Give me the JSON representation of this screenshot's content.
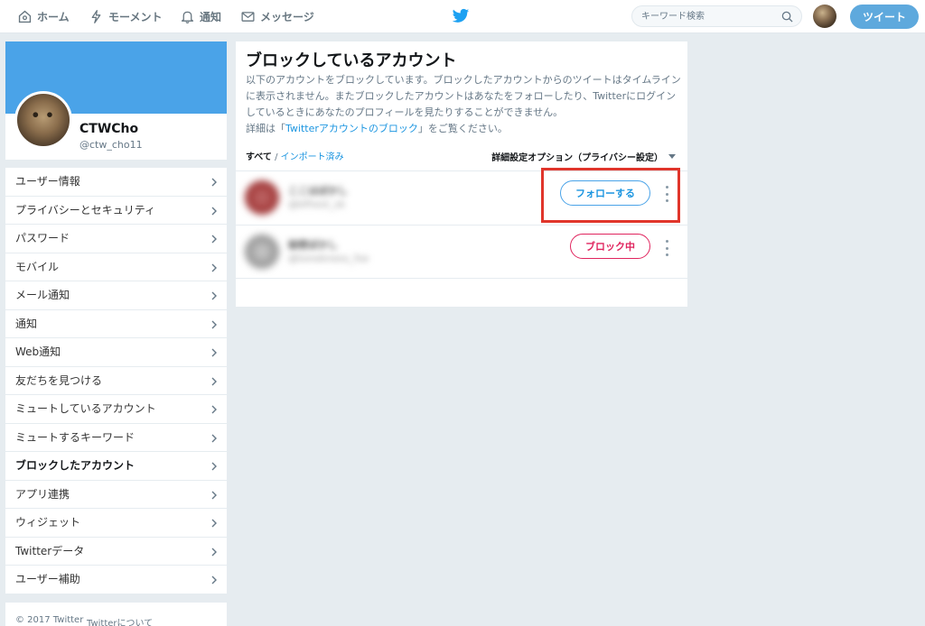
{
  "nav": {
    "home": "ホーム",
    "moments": "モーメント",
    "notifications": "通知",
    "messages": "メッセージ"
  },
  "search": {
    "placeholder": "キーワード検索"
  },
  "tweet_button": "ツイート",
  "profile": {
    "name": "CTWCho",
    "handle": "@ctw_cho11"
  },
  "menu": [
    "ユーザー情報",
    "プライバシーとセキュリティ",
    "パスワード",
    "モバイル",
    "メール通知",
    "通知",
    "Web通知",
    "友だちを見つける",
    "ミュートしているアカウント",
    "ミュートするキーワード",
    "ブロックしたアカウント",
    "アプリ連携",
    "ウィジェット",
    "Twitterデータ",
    "ユーザー補助"
  ],
  "active_menu_index": 10,
  "footer": {
    "copyright": "© 2017 Twitter",
    "about": "Twitterについて"
  },
  "panel": {
    "title": "ブロックしているアカウント",
    "desc_1": "以下のアカウントをブロックしています。ブロックしたアカウントからのツイートはタイムラインに表示されません。またブロックしたアカウントはあなたをフォローしたり、Twitterにログインしているときにあなたのプロフィールを見たりすることができません。",
    "desc_2_pre": "詳細は「",
    "desc_link": "Twitterアカウントのブロック",
    "desc_2_post": "」をご覧ください。",
    "filter_all": "すべて",
    "filter_sep": " / ",
    "filter_imported": "インポート済み",
    "advanced_options": "詳細設定オプション（プライバシー設定）"
  },
  "accounts": [
    {
      "name": "ここはぼかし",
      "handle": "@bfhest_sk",
      "button": "フォローする"
    },
    {
      "name": "秘密ぼかし",
      "handle": "@tonekness_fse",
      "button": "ブロック中"
    }
  ],
  "colors": {
    "accent": "#1b95e0",
    "banner": "#4aa3e8",
    "blocking": "#e0245e",
    "highlight": "#e0352b"
  }
}
